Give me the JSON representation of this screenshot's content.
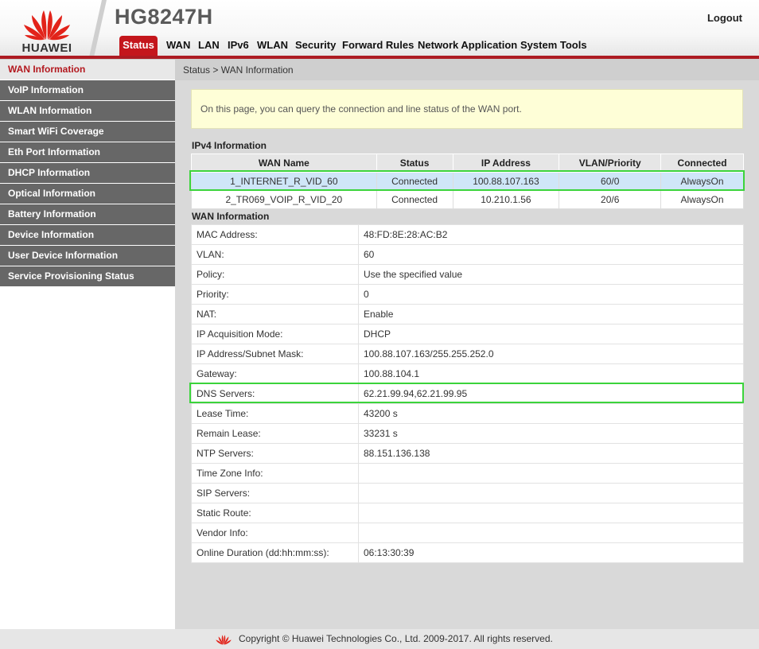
{
  "header": {
    "brand": "HUAWEI",
    "product": "HG8247H",
    "logout": "Logout",
    "nav": [
      {
        "label": "Status",
        "active": true
      },
      {
        "label": "WAN"
      },
      {
        "label": "LAN"
      },
      {
        "label": "IPv6"
      },
      {
        "label": "WLAN"
      },
      {
        "label": "Security"
      },
      {
        "label": "Forward Rules"
      },
      {
        "label": "Network Application"
      },
      {
        "label": "System Tools"
      }
    ]
  },
  "sidebar": {
    "items": [
      {
        "label": "WAN Information",
        "active": true
      },
      {
        "label": "VoIP Information"
      },
      {
        "label": "WLAN Information"
      },
      {
        "label": "Smart WiFi Coverage"
      },
      {
        "label": "Eth Port Information"
      },
      {
        "label": "DHCP Information"
      },
      {
        "label": "Optical Information"
      },
      {
        "label": "Battery Information"
      },
      {
        "label": "Device Information"
      },
      {
        "label": "User Device Information"
      },
      {
        "label": "Service Provisioning Status"
      }
    ]
  },
  "main": {
    "breadcrumb": "Status > WAN Information",
    "info_text": "On this page, you can query the connection and line status of the WAN port.",
    "ipv4_title": "IPv4 Information",
    "ipv4_table": {
      "headers": [
        "WAN Name",
        "Status",
        "IP Address",
        "VLAN/Priority",
        "Connected"
      ],
      "rows": [
        [
          "1_INTERNET_R_VID_60",
          "Connected",
          "100.88.107.163",
          "60/0",
          "AlwaysOn"
        ],
        [
          "2_TR069_VOIP_R_VID_20",
          "Connected",
          "10.210.1.56",
          "20/6",
          "AlwaysOn"
        ]
      ]
    },
    "wan_title": "WAN Information",
    "wan_details": [
      {
        "key": "MAC Address:",
        "value": "48:FD:8E:28:AC:B2"
      },
      {
        "key": "VLAN:",
        "value": "60"
      },
      {
        "key": "Policy:",
        "value": "Use the specified value"
      },
      {
        "key": "Priority:",
        "value": "0"
      },
      {
        "key": "NAT:",
        "value": "Enable"
      },
      {
        "key": "IP Acquisition Mode:",
        "value": "DHCP"
      },
      {
        "key": "IP Address/Subnet Mask:",
        "value": "100.88.107.163/255.255.252.0"
      },
      {
        "key": "Gateway:",
        "value": "100.88.104.1"
      },
      {
        "key": "DNS Servers:",
        "value": "62.21.99.94,62.21.99.95"
      },
      {
        "key": "Lease Time:",
        "value": "43200 s"
      },
      {
        "key": "Remain Lease:",
        "value": "33231 s"
      },
      {
        "key": "NTP Servers:",
        "value": "88.151.136.138"
      },
      {
        "key": "Time Zone Info:",
        "value": ""
      },
      {
        "key": "SIP Servers:",
        "value": ""
      },
      {
        "key": "Static Route:",
        "value": ""
      },
      {
        "key": "Vendor Info:",
        "value": ""
      },
      {
        "key": "Online Duration (dd:hh:mm:ss):",
        "value": "06:13:30:39"
      }
    ]
  },
  "footer": {
    "copyright": "Copyright © Huawei Technologies Co., Ltd. 2009-2017. All rights reserved."
  },
  "colors": {
    "brand_red": "#c4161c",
    "sidebar_gray": "#676767",
    "highlight_green": "#3bd43b",
    "selected_row": "#cfe6f8"
  }
}
